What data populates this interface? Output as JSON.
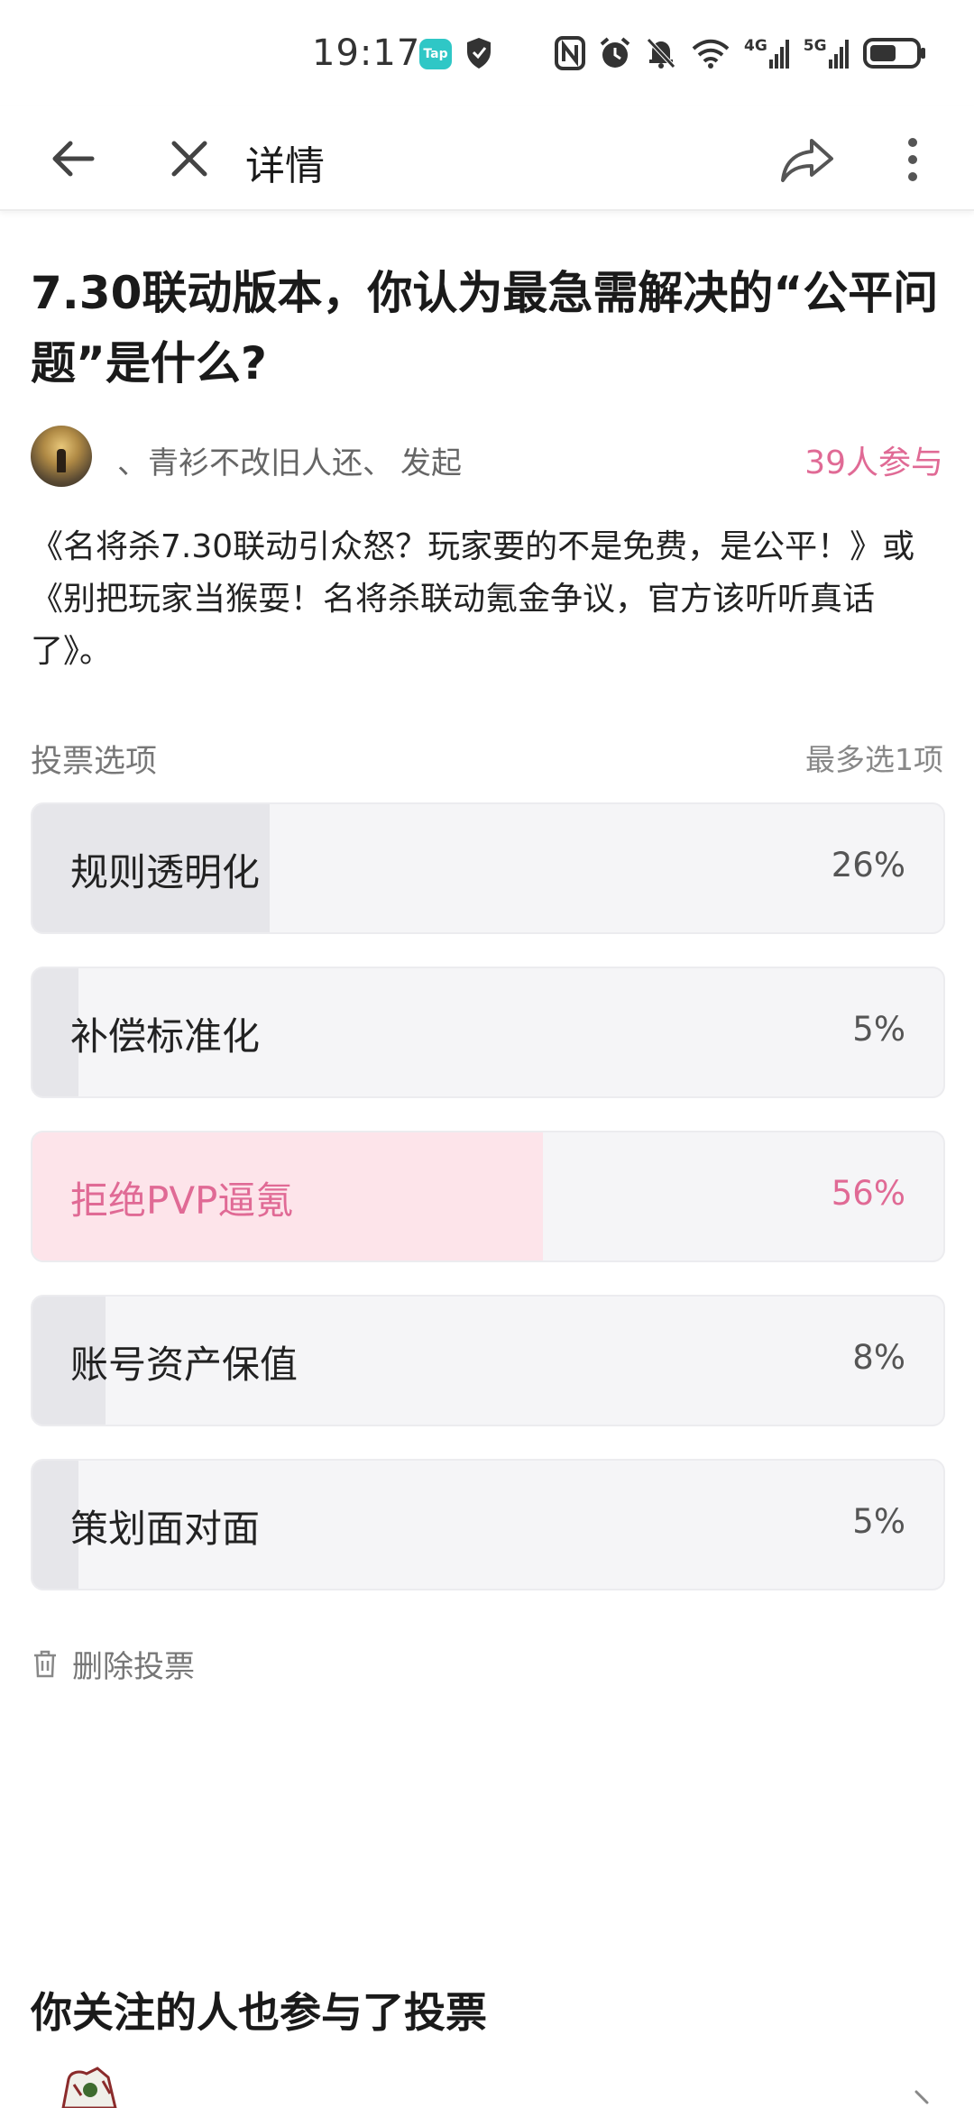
{
  "status_bar": {
    "time": "19:17",
    "app_badge": "Tap",
    "network_4g": "4G",
    "network_5g": "5G"
  },
  "toolbar": {
    "title": "详情"
  },
  "poll": {
    "title": "7.30联动版本，你认为最急需解决的“公平问题”是什么?",
    "author": "、青衫不改旧人还、",
    "author_action": "发起",
    "participants": "39人参与",
    "description": "《名将杀7.30联动引众怒？玩家要的不是免费，是公平！》或《别把玩家当猴耍！名将杀联动氪金争议，官方该听听真话了》。",
    "options_label": "投票选项",
    "options_limit": "最多选1项",
    "options": [
      {
        "label": "规则透明化",
        "percent": "26%",
        "fraction": 0.26,
        "selected": false
      },
      {
        "label": "补偿标准化",
        "percent": "5%",
        "fraction": 0.05,
        "selected": false
      },
      {
        "label": "拒绝PVP逼氪",
        "percent": "56%",
        "fraction": 0.56,
        "selected": true
      },
      {
        "label": "账号资产保值",
        "percent": "8%",
        "fraction": 0.08,
        "selected": false
      },
      {
        "label": "策划面对面",
        "percent": "5%",
        "fraction": 0.05,
        "selected": false
      }
    ],
    "delete_label": "删除投票"
  },
  "following": {
    "title": "你关注的人也参与了投票"
  },
  "colors": {
    "accent": "#e06a95",
    "selected_fill": "#fde4ea",
    "option_fill": "#e6e6ea",
    "option_bg": "#f5f5f7"
  }
}
